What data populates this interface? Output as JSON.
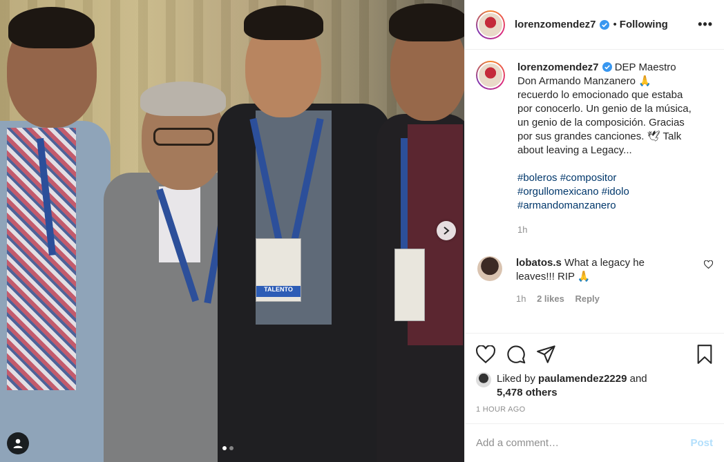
{
  "header": {
    "username": "lorenzomendez7",
    "separator": "•",
    "follow_status": "Following",
    "more_icon": "more-options-icon",
    "more_label": "•••"
  },
  "caption": {
    "username": "lorenzomendez7",
    "text": "DEP Maestro\nDon Armando Manzanero 🙏\nrecuerdo lo emocionado que estaba\npor conocerlo. Un genio de la música,\nun genio de la composición. Gracias\npor sus grandes canciones. 🕊 Talk\nabout leaving a Legacy...",
    "hashtags": [
      "#boleros",
      "#compositor",
      "#orgullomexicano",
      "#idolo",
      "#armandomanzanero"
    ],
    "time": "1h"
  },
  "comments": [
    {
      "username": "lobatos.s",
      "text": "What a legacy he leaves!!! RIP 🙏",
      "time": "1h",
      "likes": "2 likes",
      "reply": "Reply"
    }
  ],
  "media": {
    "badge_text": "TALENTO",
    "slide_count": 2,
    "active_slide": 0
  },
  "likes": {
    "prefix": "Liked by ",
    "user": "paulamendez2229",
    "and": " and",
    "others": "5,478 others"
  },
  "timestamp": "1 HOUR AGO",
  "add_comment": {
    "placeholder": "Add a comment…",
    "post_label": "Post"
  },
  "colors": {
    "link": "#00376b",
    "muted": "#8e8e8e",
    "post_disabled": "#b2dffc",
    "verified": "#3897f0"
  }
}
